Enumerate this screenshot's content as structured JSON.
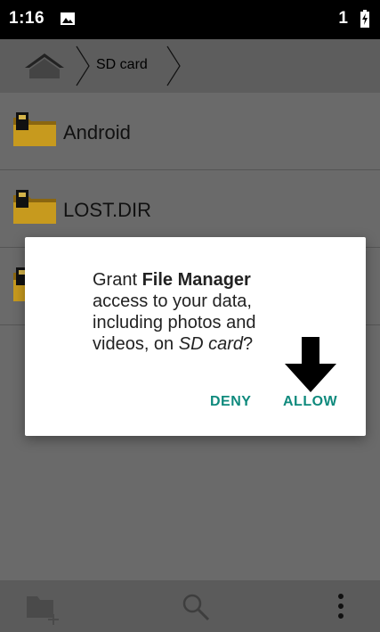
{
  "status_bar": {
    "time": "1:16",
    "notification_count": "1"
  },
  "breadcrumb": {
    "current": "SD card"
  },
  "files": [
    {
      "name": "Android"
    },
    {
      "name": "LOST.DIR"
    },
    {
      "name": ""
    }
  ],
  "dialog": {
    "message_prefix": "Grant ",
    "app_name": "File Manager",
    "message_middle": " access to your data, including photos and videos, on ",
    "storage_name": "SD card",
    "message_suffix": "?",
    "deny_label": "DENY",
    "allow_label": "ALLOW"
  },
  "colors": {
    "accent": "#0f8a7d",
    "folder": "#c79a1e"
  },
  "icons": [
    "image-icon",
    "battery-charging-icon",
    "home-icon",
    "folder-sd-icon",
    "new-folder-icon",
    "search-icon",
    "more-vert-icon",
    "down-arrow-icon"
  ]
}
